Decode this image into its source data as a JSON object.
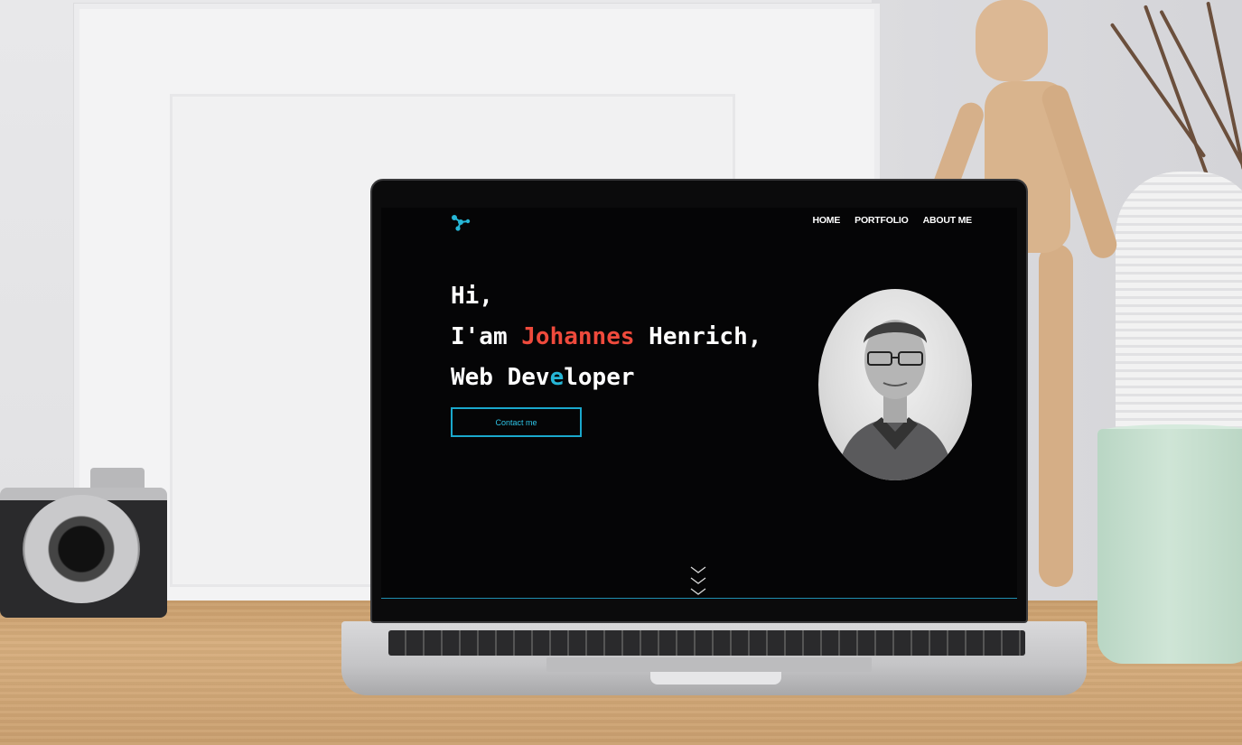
{
  "nav": {
    "items": [
      {
        "label": "HOME"
      },
      {
        "label": "PORTFOLIO"
      },
      {
        "label": "ABOUT ME"
      }
    ]
  },
  "hero": {
    "line1": "Hi,",
    "line2_prefix": "I'am ",
    "line2_name": "Johannes",
    "line2_suffix": " Henrich,",
    "line3_a": "Web Dev",
    "line3_accent": "e",
    "line3_b": "loper"
  },
  "contact_button": {
    "label": "Contact me"
  },
  "colors": {
    "accent_cyan": "#26b6d6",
    "accent_red": "#ef4a3c",
    "screen_bg": "#050506"
  },
  "icons": {
    "logo": "molecule-logo-icon",
    "scroll": "triple-chevron-down-icon"
  }
}
